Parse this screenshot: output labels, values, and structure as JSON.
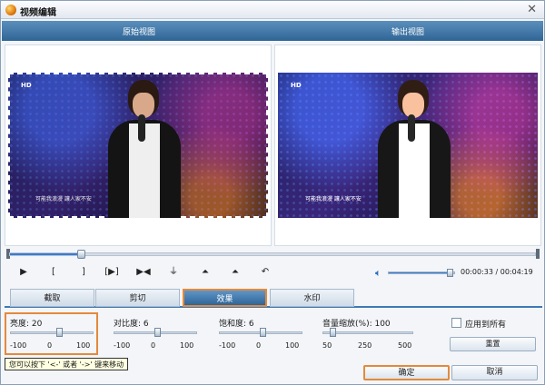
{
  "window": {
    "title": "视频编辑"
  },
  "views": {
    "left_label": "原始视图",
    "right_label": "输出视图"
  },
  "video": {
    "channel_logo": "HD",
    "subtitle": "可能我浪漫 讓人家不安"
  },
  "timeline": {
    "progress": 0.135
  },
  "playback": {
    "buttons": [
      {
        "name": "play-button",
        "glyph": "▶"
      },
      {
        "name": "mark-in-button",
        "glyph": "["
      },
      {
        "name": "mark-out-button",
        "glyph": "]"
      },
      {
        "name": "play-selection-button",
        "glyph": "[▶]"
      },
      {
        "name": "next-frame-button",
        "glyph": "▶◀"
      },
      {
        "name": "flip-vertical-button",
        "glyph": "⏚"
      },
      {
        "name": "rotate-left-button",
        "glyph": "⏶"
      },
      {
        "name": "rotate-right-button",
        "glyph": "⏶"
      },
      {
        "name": "undo-button",
        "glyph": "↶"
      }
    ],
    "volume": 0.95,
    "current_time": "00:00:33",
    "total_time": "00:04:19",
    "time_separator": "/"
  },
  "tabs": [
    "截取",
    "剪切",
    "效果",
    "水印"
  ],
  "active_tab": 2,
  "effects": {
    "brightness": {
      "label": "亮度:",
      "value": "20",
      "min": "-100",
      "mid": "0",
      "max": "100",
      "level": 0.6
    },
    "contrast": {
      "label": "对比度:",
      "value": "6",
      "min": "-100",
      "mid": "0",
      "max": "100",
      "level": 0.53
    },
    "saturation": {
      "label": "饱和度:",
      "value": "6",
      "min": "-100",
      "mid": "0",
      "max": "100",
      "level": 0.53
    },
    "volume_zoom": {
      "label": "音量缩放(%):",
      "value": "100",
      "min": "50",
      "mid": "250",
      "max": "500",
      "level": 0.11
    }
  },
  "apply_all": {
    "label": "应用到所有",
    "checked": false
  },
  "reset_label": "重置",
  "tooltip": "您可以按下 '<-' 或者 '->' 键来移动",
  "footer": {
    "ok_label": "确定",
    "cancel_label": "取消"
  },
  "colors": {
    "accent": "#3d79b6",
    "highlight": "#e3893c"
  }
}
